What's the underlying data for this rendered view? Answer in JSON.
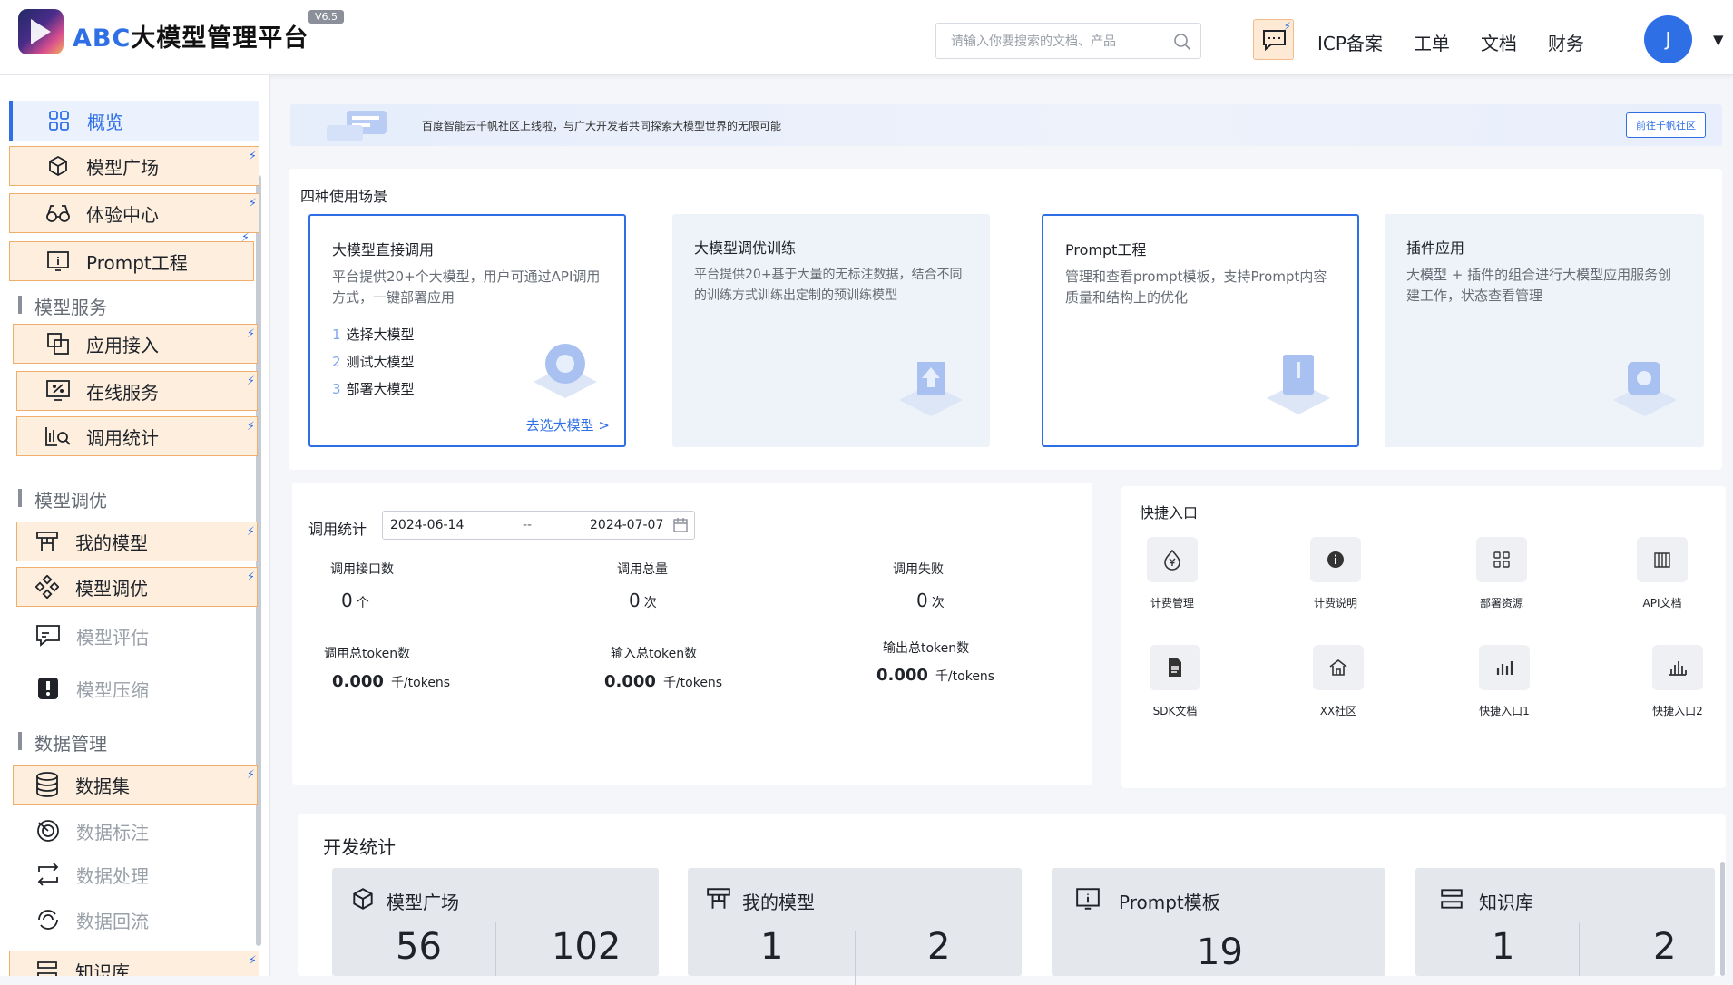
{
  "header": {
    "brand_prefix": "ABC",
    "brand_name": "大模型管理平台",
    "version": "V6.5",
    "search_placeholder": "请输入你要搜索的文档、产品",
    "nav": [
      "ICP备案",
      "工单",
      "文档",
      "财务"
    ],
    "avatar_initial": "J"
  },
  "sidebar": {
    "overview": "概览",
    "model_square": "模型广场",
    "experience": "体验中心",
    "prompt": "Prompt工程",
    "group_service": "模型服务",
    "app_access": "应用接入",
    "online_service": "在线服务",
    "call_stats": "调用统计",
    "group_tune": "模型调优",
    "my_models": "我的模型",
    "model_tune": "模型调优",
    "model_eval": "模型评估",
    "model_compress": "模型压缩",
    "group_data": "数据管理",
    "dataset": "数据集",
    "data_label": "数据标注",
    "data_process": "数据处理",
    "data_reflow": "数据回流",
    "knowledge": "知识库"
  },
  "banner": {
    "text": "百度智能云千帆社区上线啦，与广大开发者共同探索大模型世界的无限可能",
    "link": "前往千帆社区"
  },
  "scenes": {
    "title": "四种使用场景",
    "items": [
      {
        "title": "大模型直接调用",
        "desc": "平台提供20+个大模型，用户可通过API调用方式，一键部署应用",
        "steps": [
          {
            "n": "1",
            "t": "选择大模型"
          },
          {
            "n": "2",
            "t": "测试大模型"
          },
          {
            "n": "3",
            "t": "部署大模型"
          }
        ],
        "link": "去选大模型 >"
      },
      {
        "title": "大模型调优训练",
        "desc": "平台提供20+基于大量的无标注数据，结合不同的训练方式训练出定制的预训练模型"
      },
      {
        "title": "Prompt工程",
        "desc": "管理和查看prompt模板，支持Prompt内容质量和结构上的优化"
      },
      {
        "title": "插件应用",
        "desc": "大模型 + 插件的组合进行大模型应用服务创建工作，状态查看管理"
      }
    ]
  },
  "stats": {
    "title": "调用统计",
    "date_start": "2024-06-14",
    "date_sep": "--",
    "date_end": "2024-07-07",
    "api_count_label": "调用接口数",
    "api_count": "0",
    "api_count_unit": "个",
    "total_calls_label": "调用总量",
    "total_calls": "0",
    "total_calls_unit": "次",
    "failed_label": "调用失败",
    "failed": "0",
    "failed_unit": "次",
    "total_tokens_label": "调用总token数",
    "total_tokens": "0.000",
    "input_tokens_label": "输入总token数",
    "input_tokens": "0.000",
    "output_tokens_label": "输出总token数",
    "output_tokens": "0.000",
    "token_unit": "千/tokens"
  },
  "quick": {
    "title": "快捷入口",
    "items": [
      "计费管理",
      "计费说明",
      "部署资源",
      "API文档",
      "SDK文档",
      "XX社区",
      "快捷入口1",
      "快捷入口2"
    ]
  },
  "dev": {
    "title": "开发统计",
    "cards": [
      {
        "title": "模型广场",
        "a": "56",
        "b": "102"
      },
      {
        "title": "我的模型",
        "a": "1",
        "b": "2"
      },
      {
        "title": "Prompt模板",
        "a": "19"
      },
      {
        "title": "知识库",
        "a": "1",
        "b": "2"
      }
    ]
  },
  "colors": {
    "accent": "#2f6fe6",
    "highlight_bg": "#fdeedd",
    "highlight_border": "#f0ae6b"
  }
}
